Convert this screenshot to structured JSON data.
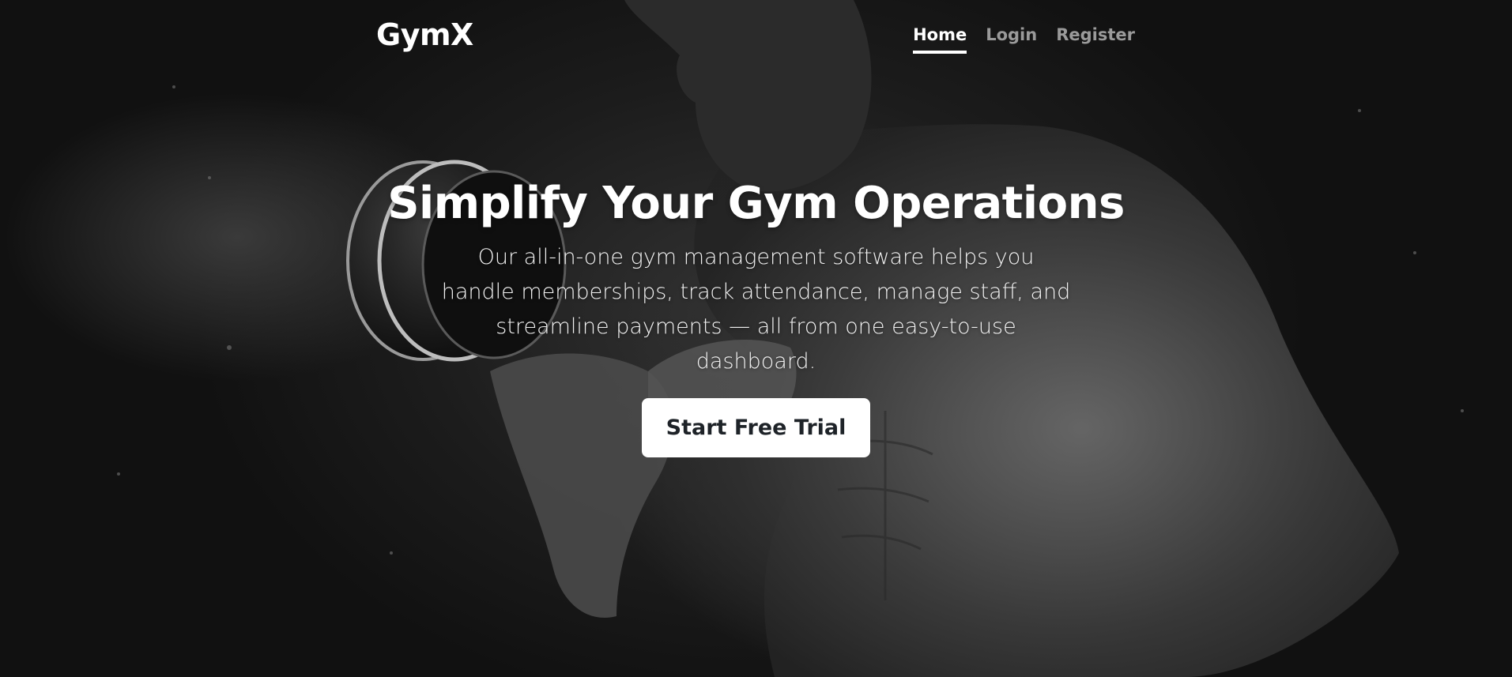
{
  "nav": {
    "brand": "GymX",
    "links": [
      {
        "label": "Home",
        "active": true
      },
      {
        "label": "Login",
        "active": false
      },
      {
        "label": "Register",
        "active": false
      }
    ]
  },
  "hero": {
    "title": "Simplify Your Gym Operations",
    "subtitle": "Our all-in-one gym management software helps you handle memberships, track attendance, manage staff, and streamline payments — all from one easy-to-use dashboard.",
    "cta_label": "Start Free Trial",
    "background_image": "Black-and-white photo of a muscular man lifting a dumbbell"
  },
  "colors": {
    "background": "#151515",
    "text_primary": "#ffffff",
    "nav_inactive": "#9a9a9a",
    "cta_background": "#ffffff",
    "cta_text": "#1e2328"
  }
}
